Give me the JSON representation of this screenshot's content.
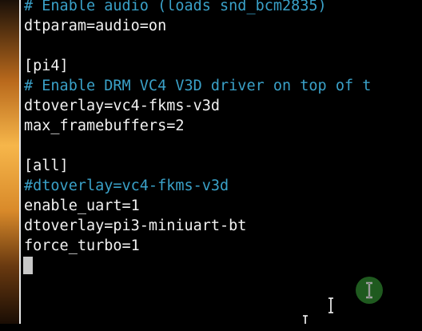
{
  "terminal": {
    "lines": [
      {
        "text": "# Enable audio (loads snd_bcm2835)",
        "kind": "comment"
      },
      {
        "text": "dtparam=audio=on",
        "kind": "plain"
      },
      {
        "text": "",
        "kind": "plain"
      },
      {
        "text": "[pi4]",
        "kind": "plain"
      },
      {
        "text": "# Enable DRM VC4 V3D driver on top of t",
        "kind": "comment"
      },
      {
        "text": "dtoverlay=vc4-fkms-v3d",
        "kind": "plain"
      },
      {
        "text": "max_framebuffers=2",
        "kind": "plain"
      },
      {
        "text": "",
        "kind": "plain"
      },
      {
        "text": "[all]",
        "kind": "plain"
      },
      {
        "text": "#dtoverlay=vc4-fkms-v3d",
        "kind": "comment"
      },
      {
        "text": "enable_uart=1",
        "kind": "plain"
      },
      {
        "text": "dtoverlay=pi3-miniuart-bt",
        "kind": "plain"
      },
      {
        "text": "force_turbo=1",
        "kind": "plain"
      }
    ]
  },
  "colors": {
    "background": "#000000",
    "text": "#f2f2f2",
    "comment": "#3aa1c8",
    "cursor": "#c8c8c8",
    "pointer_highlight": "#1f5a1f"
  },
  "icons": {
    "text_cursor": "i-beam-cursor-icon",
    "pointer": "i-beam-pointer-icon"
  }
}
